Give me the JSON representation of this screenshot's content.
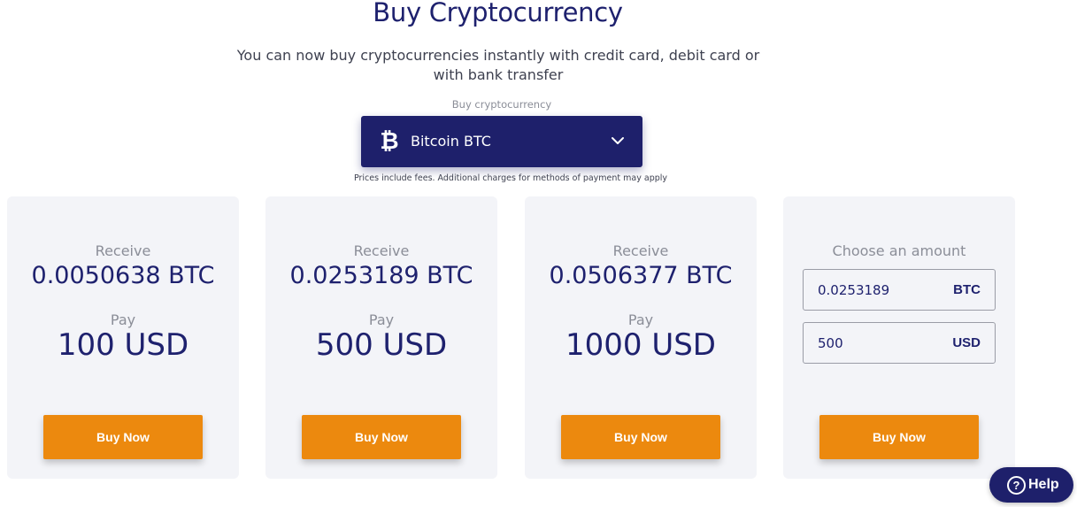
{
  "header": {
    "title": "Buy Cryptocurrency",
    "subtitle": "You can now buy cryptocurrencies instantly with credit card, debit card or with bank transfer"
  },
  "selector": {
    "label": "Buy cryptocurrency",
    "selected": "Bitcoin BTC",
    "icon": "bitcoin-icon"
  },
  "fees_note": "Prices include fees. Additional charges for methods of payment may apply",
  "offers": [
    {
      "receive_label": "Receive",
      "crypto_amount": "0.0050638 BTC",
      "pay_label": "Pay",
      "fiat_amount": "100 USD",
      "button": "Buy Now"
    },
    {
      "receive_label": "Receive",
      "crypto_amount": "0.0253189 BTC",
      "pay_label": "Pay",
      "fiat_amount": "500 USD",
      "button": "Buy Now"
    },
    {
      "receive_label": "Receive",
      "crypto_amount": "0.0506377 BTC",
      "pay_label": "Pay",
      "fiat_amount": "1000 USD",
      "button": "Buy Now"
    }
  ],
  "custom": {
    "label": "Choose an amount",
    "crypto_value": "0.0253189",
    "crypto_unit": "BTC",
    "fiat_value": "500",
    "fiat_unit": "USD",
    "button": "Buy Now"
  },
  "help": {
    "label": "Help",
    "icon": "question-circle-icon"
  },
  "colors": {
    "brand": "#1e206b",
    "accent": "#ec890e",
    "card_bg": "#f3f4f8"
  }
}
